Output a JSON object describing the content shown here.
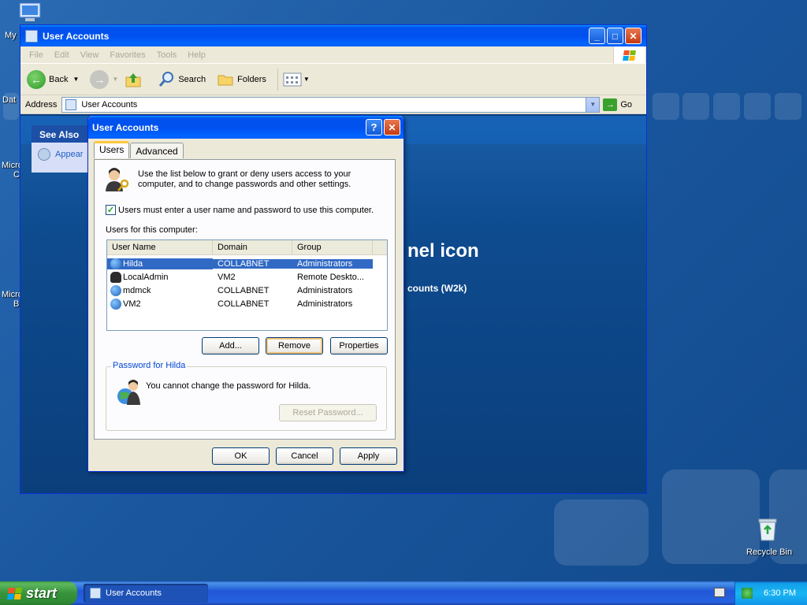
{
  "desktop": {
    "my_label": "My",
    "dat_label": "Dat",
    "micro_label_1": "Micro",
    "c_label": "C",
    "micro_label_2": "Micro",
    "b_label": "B",
    "recycle_bin": "Recycle Bin"
  },
  "explorer": {
    "title": "User Accounts",
    "menu": [
      "File",
      "Edit",
      "View",
      "Favorites",
      "Tools",
      "Help"
    ],
    "toolbar": {
      "back": "Back",
      "search": "Search",
      "folders": "Folders"
    },
    "address_label": "Address",
    "address_value": "User Accounts",
    "go_label": "Go",
    "see_also": {
      "header": "See Also",
      "item": "Appear"
    },
    "bg_text_1": "nel icon",
    "bg_text_2": "counts (W2k)"
  },
  "dialog": {
    "title": "User Accounts",
    "help_btn": "?",
    "tabs": [
      "Users",
      "Advanced"
    ],
    "intro": "Use the list below to grant or deny users access to your computer, and to change passwords and other settings.",
    "checkbox_label": "Users must enter a user name and password to use this computer.",
    "checkbox_checked": true,
    "list_label": "Users for this computer:",
    "columns": [
      "User Name",
      "Domain",
      "Group"
    ],
    "users": [
      {
        "name": "Hilda",
        "domain": "COLLABNET",
        "group": "Administrators",
        "selected": true
      },
      {
        "name": "LocalAdmin",
        "domain": "VM2",
        "group": "Remote Deskto...",
        "selected": false
      },
      {
        "name": "mdmck",
        "domain": "COLLABNET",
        "group": "Administrators",
        "selected": false
      },
      {
        "name": "VM2",
        "domain": "COLLABNET",
        "group": "Administrators",
        "selected": false
      }
    ],
    "buttons": {
      "add": "Add...",
      "remove": "Remove",
      "properties": "Properties"
    },
    "password_group": "Password for Hilda",
    "password_text": "You cannot change the password for Hilda.",
    "reset_password": "Reset Password...",
    "ok": "OK",
    "cancel": "Cancel",
    "apply": "Apply"
  },
  "taskbar": {
    "start": "start",
    "task_item": "User Accounts",
    "clock": "6:30 PM"
  },
  "colors": {
    "xp_blue": "#0053ee",
    "selection": "#316ac5",
    "start_green": "#36923b"
  }
}
